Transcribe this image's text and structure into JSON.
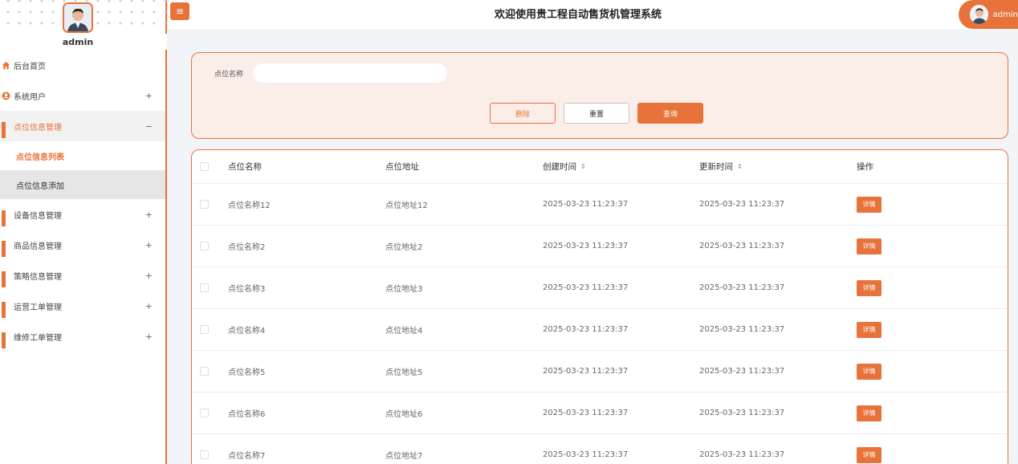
{
  "app": {
    "title": "欢迎使用贵工程自动售货机管理系统",
    "menu_toggle_icon": "≡",
    "accent_color": "#e8733a"
  },
  "user": {
    "name": "admin",
    "header_name": "admin"
  },
  "sidebar": {
    "items": [
      {
        "label": "后台首页",
        "icon": "home-icon",
        "toggle": ""
      },
      {
        "label": "系统用户",
        "icon": "user-circle-icon",
        "toggle": "+"
      },
      {
        "label": "点位信息管理",
        "icon": "grid-icon",
        "toggle": "−"
      },
      {
        "label": "设备信息管理",
        "icon": "grid-icon",
        "toggle": "+"
      },
      {
        "label": "商品信息管理",
        "icon": "grid-icon",
        "toggle": "+"
      },
      {
        "label": "策略信息管理",
        "icon": "grid-icon",
        "toggle": "+"
      },
      {
        "label": "运营工单管理",
        "icon": "grid-icon",
        "toggle": "+"
      },
      {
        "label": "维修工单管理",
        "icon": "grid-icon",
        "toggle": "+"
      }
    ],
    "submenu": [
      {
        "label": "点位信息列表"
      },
      {
        "label": "点位信息添加"
      }
    ]
  },
  "search": {
    "label": "点位名称",
    "value": "",
    "placeholder": "",
    "delete_label": "删除",
    "reset_label": "重置",
    "query_label": "查询"
  },
  "table": {
    "headers": {
      "name": "点位名称",
      "address": "点位地址",
      "created": "创建时间",
      "updated": "更新时间",
      "actions": "操作",
      "sort_icon": "⇕"
    },
    "detail_label": "详情",
    "rows": [
      {
        "name": "点位名称12",
        "address": "点位地址12",
        "created": "2025-03-23 11:23:37",
        "updated": "2025-03-23 11:23:37"
      },
      {
        "name": "点位名称2",
        "address": "点位地址2",
        "created": "2025-03-23 11:23:37",
        "updated": "2025-03-23 11:23:37"
      },
      {
        "name": "点位名称3",
        "address": "点位地址3",
        "created": "2025-03-23 11:23:37",
        "updated": "2025-03-23 11:23:37"
      },
      {
        "name": "点位名称4",
        "address": "点位地址4",
        "created": "2025-03-23 11:23:37",
        "updated": "2025-03-23 11:23:37"
      },
      {
        "name": "点位名称5",
        "address": "点位地址5",
        "created": "2025-03-23 11:23:37",
        "updated": "2025-03-23 11:23:37"
      },
      {
        "name": "点位名称6",
        "address": "点位地址6",
        "created": "2025-03-23 11:23:37",
        "updated": "2025-03-23 11:23:37"
      },
      {
        "name": "点位名称7",
        "address": "点位地址7",
        "created": "2025-03-23 11:23:37",
        "updated": "2025-03-23 11:23:37"
      }
    ]
  }
}
